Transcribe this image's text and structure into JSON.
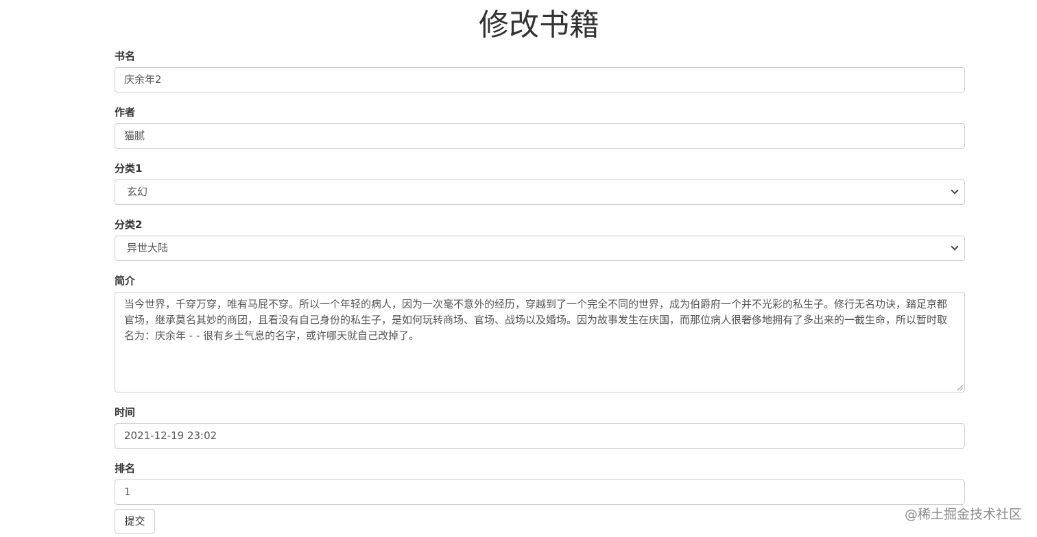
{
  "page": {
    "title": "修改书籍"
  },
  "form": {
    "book_name": {
      "label": "书名",
      "value": "庆余年2"
    },
    "author": {
      "label": "作者",
      "value": "猫腻"
    },
    "category1": {
      "label": "分类1",
      "value": "玄幻"
    },
    "category2": {
      "label": "分类2",
      "value": "异世大陆"
    },
    "intro": {
      "label": "简介",
      "value": "当今世界，千穿万穿，唯有马屁不穿。所以一个年轻的病人，因为一次毫不意外的经历，穿越到了一个完全不同的世界，成为伯爵府一个并不光彩的私生子。修行无名功诀，踏足京都官场，继承莫名其妙的商团，且看没有自己身份的私生子，是如何玩转商场、官场、战场以及婚场。因为故事发生在庆国，而那位病人很奢侈地拥有了多出来的一截生命，所以暂时取名为：庆余年 - - 很有乡土气息的名字，或许哪天就自己改掉了。"
    },
    "time": {
      "label": "时间",
      "value": "2021-12-19 23:02"
    },
    "rank": {
      "label": "排名",
      "value": "1"
    },
    "submit_label": "提交"
  },
  "watermark": "@稀土掘金技术社区",
  "icons": {
    "select_arrow": "chevron-down-icon",
    "resize": "resize-grip-icon"
  },
  "colors": {
    "border": "#cccccc",
    "label_text": "#333333",
    "value_text": "#555555",
    "watermark": "#8a8a8a"
  }
}
